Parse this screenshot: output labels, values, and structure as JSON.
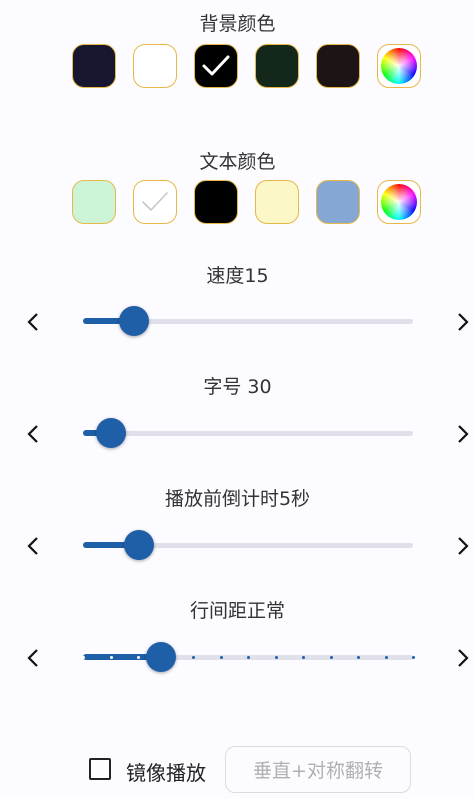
{
  "background_color": {
    "title": "背景颜色",
    "swatches": [
      {
        "color": "#161630",
        "selected": false
      },
      {
        "color": "#ffffff",
        "selected": false
      },
      {
        "color": "#000000",
        "selected": true
      },
      {
        "color": "#13281a",
        "selected": false
      },
      {
        "color": "#1d1515",
        "selected": false
      }
    ],
    "picker_icon": "color-wheel-icon"
  },
  "text_color": {
    "title": "文本颜色",
    "swatches": [
      {
        "color": "#ccf5d8",
        "selected": false
      },
      {
        "color": "#ffffff",
        "selected": true
      },
      {
        "color": "#000000",
        "selected": false
      },
      {
        "color": "#fbf7c6",
        "selected": false
      },
      {
        "color": "#86a7d3",
        "selected": false
      }
    ],
    "picker_icon": "color-wheel-icon"
  },
  "speed": {
    "label": "速度15",
    "fraction": 0.155
  },
  "font_size": {
    "label": "字号 30",
    "fraction": 0.085
  },
  "countdown": {
    "label": "播放前倒计时5秒",
    "fraction": 0.17
  },
  "line_spacing": {
    "label": "行间距正常",
    "fraction": 0.235,
    "steps": 13
  },
  "mirror_checkbox": {
    "label": "镜像播放",
    "checked": false
  },
  "flip_button": {
    "label": "垂直+对称翻转",
    "enabled": false
  },
  "accent_color": "#1f5fa8",
  "swatch_border_color": "#e6b84a"
}
